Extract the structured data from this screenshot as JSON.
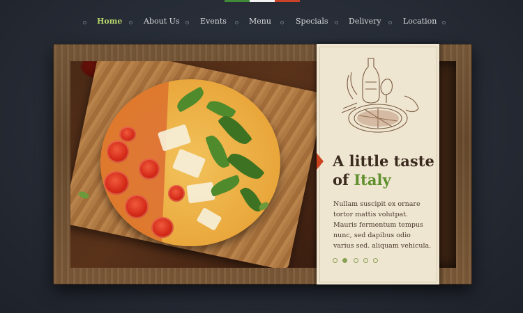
{
  "colors": {
    "background": "#262b35",
    "nav_active": "#b3d36b",
    "nav_text": "#d8d9dc",
    "accent_green": "#5f8f2b",
    "accent_red": "#c9431f",
    "panel": "#efe6d2",
    "flag": [
      "#3f8b3a",
      "#f2f2f2",
      "#c9432b"
    ]
  },
  "nav": {
    "items": [
      {
        "label": "Home",
        "active": true
      },
      {
        "label": "About Us",
        "active": false
      },
      {
        "label": "Events",
        "active": false
      },
      {
        "label": "Menu",
        "active": false
      },
      {
        "label": "Specials",
        "active": false
      },
      {
        "label": "Delivery",
        "active": false
      },
      {
        "label": "Location",
        "active": false
      }
    ]
  },
  "hero": {
    "title_line1": "A little taste",
    "title_prefix": "of ",
    "title_highlight": "Italy",
    "body": "Nullam suscipit ex ornare tortor mattis volutpat. Mauris fermentum tempus nunc, sed dapibus odio varius sed. aliquam vehicula.",
    "slider": {
      "count": 5,
      "active_index": 1
    }
  },
  "icons": {
    "bullet": "nav-bullet-icon",
    "sketch": "wine-and-pizza-sketch"
  }
}
